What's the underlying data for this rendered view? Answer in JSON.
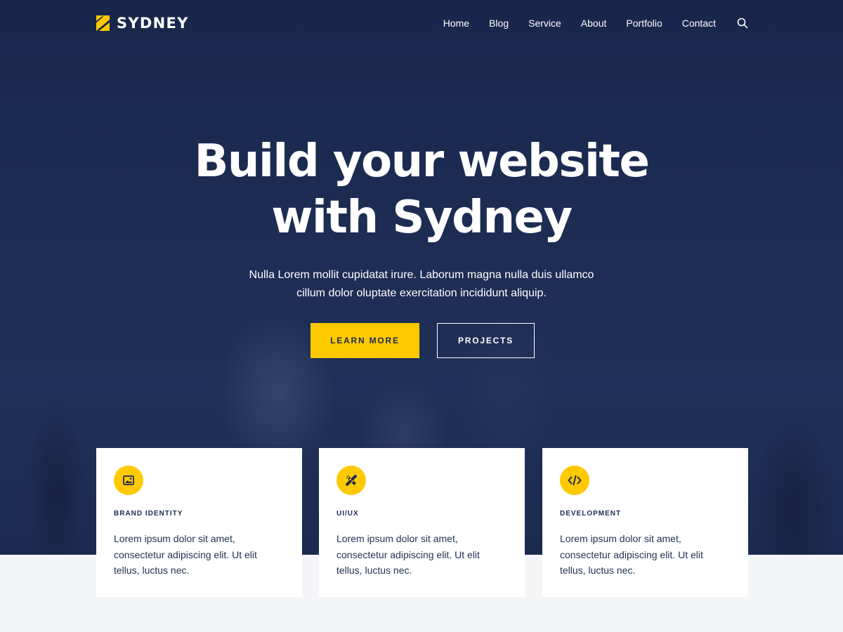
{
  "header": {
    "logo_text": "SYDNEY",
    "nav": [
      "Home",
      "Blog",
      "Service",
      "About",
      "Portfolio",
      "Contact"
    ],
    "search_icon": "search-icon"
  },
  "hero": {
    "title_line1": "Build your website",
    "title_line2": "with Sydney",
    "subtitle_line1": "Nulla Lorem mollit cupidatat irure. Laborum magna nulla duis ullamco",
    "subtitle_line2": "cillum dolor oluptate exercitation incididunt aliquip.",
    "primary_button": "LEARN MORE",
    "secondary_button": "PROJECTS"
  },
  "services": [
    {
      "icon": "image-icon",
      "title": "BRAND IDENTITY",
      "text_line1": "Lorem ipsum dolor sit amet,",
      "text_line2": "consectetur adipiscing elit. Ut elit",
      "text_line3": "tellus, luctus nec."
    },
    {
      "icon": "design-tools-icon",
      "title": "UI/UX",
      "text_line1": "Lorem ipsum dolor sit amet,",
      "text_line2": "consectetur adipiscing elit. Ut elit",
      "text_line3": "tellus, luctus nec."
    },
    {
      "icon": "code-icon",
      "title": "DEVELOPMENT",
      "text_line1": "Lorem ipsum dolor sit amet,",
      "text_line2": "consectetur adipiscing elit. Ut elit",
      "text_line3": "tellus, luctus nec."
    }
  ],
  "colors": {
    "hero_bg": "#1c2b4f",
    "accent": "#ffc900",
    "page_bg": "#f4f5f7",
    "card_bg": "#ffffff",
    "text_dark": "#1c2b4f"
  }
}
